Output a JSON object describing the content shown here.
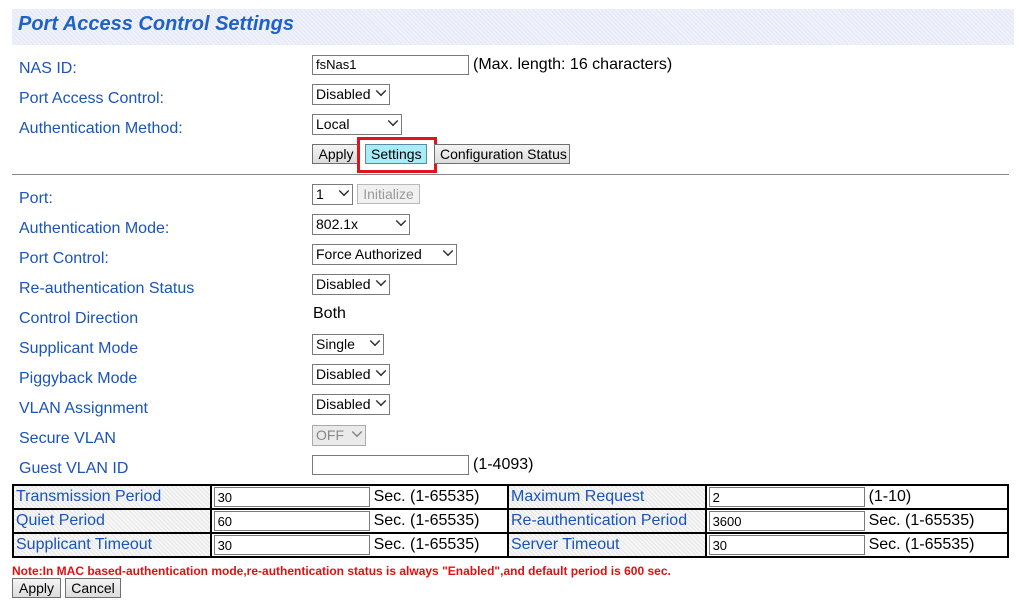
{
  "page": {
    "title": "Port Access Control Settings"
  },
  "global": {
    "nas_id_label": "NAS ID:",
    "nas_id_value": "fsNas1",
    "nas_id_hint": "(Max. length: 16 characters)",
    "port_access_label": "Port Access Control:",
    "port_access_value": "Disabled",
    "auth_method_label": "Authentication Method:",
    "auth_method_value": "Local",
    "apply_label": "Apply",
    "settings_label": "Settings",
    "config_status_label": "Configuration Status"
  },
  "port": {
    "port_label": "Port:",
    "port_value": "1",
    "initialize_label": "Initialize",
    "auth_mode_label": "Authentication Mode:",
    "auth_mode_value": "802.1x",
    "port_control_label": "Port Control:",
    "port_control_value": "Force Authorized",
    "reauth_status_label": "Re-authentication Status",
    "reauth_status_value": "Disabled",
    "control_direction_label": "Control Direction",
    "control_direction_value": "Both",
    "supplicant_mode_label": "Supplicant Mode",
    "supplicant_mode_value": "Single",
    "piggyback_label": "Piggyback Mode",
    "piggyback_value": "Disabled",
    "vlan_assign_label": "VLAN Assignment",
    "vlan_assign_value": "Disabled",
    "secure_vlan_label": "Secure VLAN",
    "secure_vlan_value": "OFF",
    "guest_vlan_label": "Guest VLAN ID",
    "guest_vlan_value": "",
    "guest_vlan_hint": "(1-4093)"
  },
  "timers": {
    "transmission_label": "Transmission Period",
    "transmission_value": "30",
    "transmission_unit": "Sec. (1-65535)",
    "max_request_label": "Maximum Request",
    "max_request_value": "2",
    "max_request_unit": "(1-10)",
    "quiet_label": "Quiet Period",
    "quiet_value": "60",
    "quiet_unit": "Sec. (1-65535)",
    "reauth_period_label": "Re-authentication Period",
    "reauth_period_value": "3600",
    "reauth_period_unit": "Sec. (1-65535)",
    "supp_timeout_label": "Supplicant Timeout",
    "supp_timeout_value": "30",
    "supp_timeout_unit": "Sec. (1-65535)",
    "server_timeout_label": "Server Timeout",
    "server_timeout_value": "30",
    "server_timeout_unit": "Sec. (1-65535)"
  },
  "footer": {
    "note": "Note:In MAC based-authentication mode,re-authentication status is always \"Enabled\",and default period is 600 sec.",
    "apply_label": "Apply",
    "cancel_label": "Cancel"
  }
}
